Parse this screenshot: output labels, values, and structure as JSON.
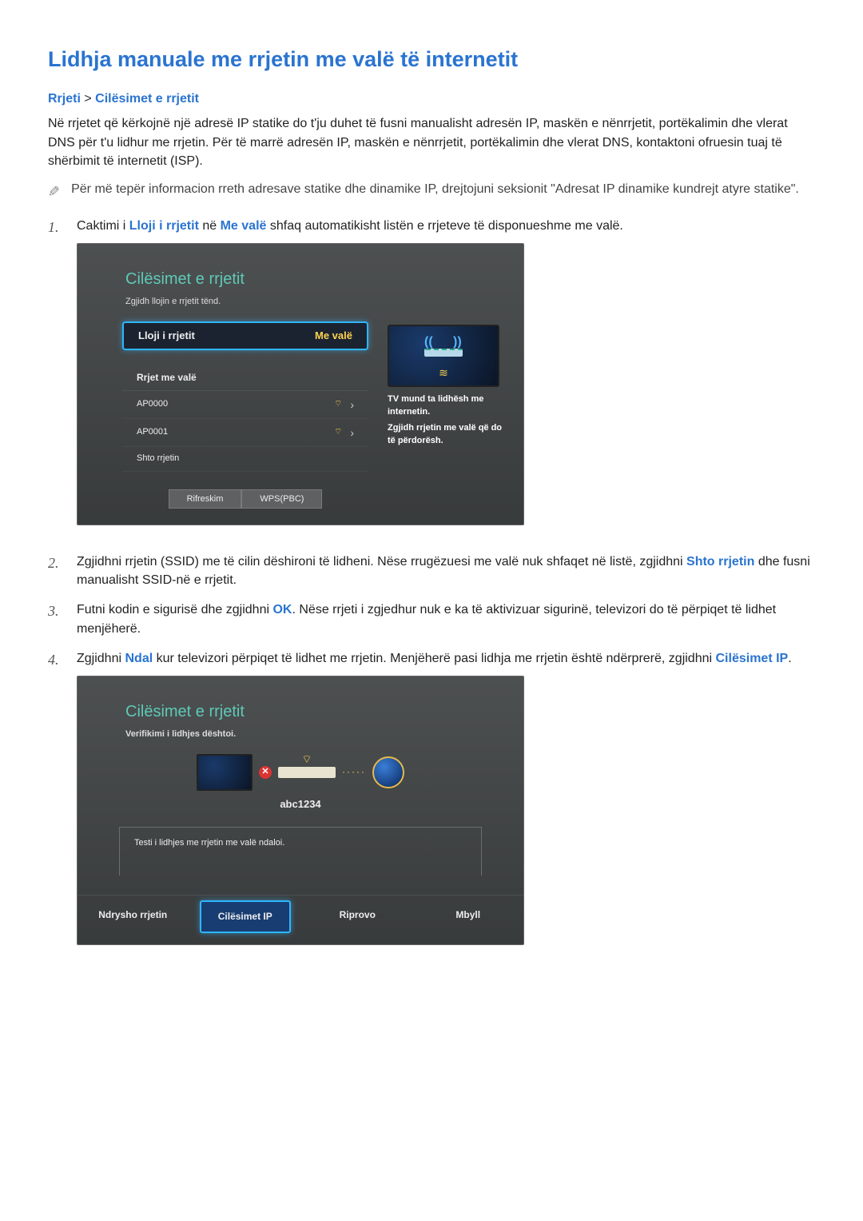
{
  "title": "Lidhja manuale me rrjetin me valë të internetit",
  "breadcrumb": {
    "a": "Rrjeti",
    "sep": ">",
    "b": "Cilësimet e rrjetit"
  },
  "intro": "Në rrjetet që kërkojnë një adresë IP statike do t'ju duhet të fusni manualisht adresën IP, maskën e nënrrjetit, portëkalimin dhe vlerat DNS për t'u lidhur me rrjetin. Për të marrë adresën IP, maskën e nënrrjetit, portëkalimin dhe vlerat DNS, kontaktoni ofruesin tuaj të shërbimit të internetit (ISP).",
  "note": "Për më tepër informacion rreth adresave statike dhe dinamike IP, drejtojuni seksionit \"Adresat IP dinamike kundrejt atyre statike\".",
  "steps": {
    "s1": {
      "num": "1.",
      "pre": "Caktimi i ",
      "kw1": "Lloji i rrjetit",
      "mid": " në ",
      "kw2": "Me valë",
      "post": " shfaq automatikisht listën e rrjeteve të disponueshme me valë."
    },
    "s2": {
      "num": "2.",
      "pre": "Zgjidhni rrjetin (SSID) me të cilin dëshironi të lidheni. Nëse rrugëzuesi me valë nuk shfaqet në listë, zgjidhni ",
      "kw": "Shto rrjetin",
      "post": " dhe fusni manualisht SSID-në e rrjetit."
    },
    "s3": {
      "num": "3.",
      "pre": "Futni kodin e sigurisë dhe zgjidhni ",
      "kw": "OK",
      "post": ". Nëse rrjeti i zgjedhur nuk e ka të aktivizuar sigurinë, televizori do të përpiqet të lidhet menjëherë."
    },
    "s4": {
      "num": "4.",
      "pre": "Zgjidhni ",
      "kw1": "Ndal",
      "mid": " kur televizori përpiqet të lidhet me rrjetin. Menjëherë pasi lidhja me rrjetin është ndërprerë, zgjidhni ",
      "kw2": "Cilësimet IP",
      "post": "."
    }
  },
  "panel1": {
    "title": "Cilësimet e rrjetit",
    "subtitle": "Zgjidh llojin e rrjetit tënd.",
    "type_label": "Lloji i rrjetit",
    "type_value": "Me valë",
    "group": "Rrjet me valë",
    "ap0": "AP0000",
    "ap1": "AP0001",
    "add": "Shto rrjetin",
    "refresh": "Rifreskim",
    "wps": "WPS(PBC)",
    "cap1": "TV mund ta lidhësh me internetin.",
    "cap2": "Zgjidh rrjetin me valë që do të përdorësh."
  },
  "panel2": {
    "title": "Cilësimet e rrjetit",
    "subtitle": "Verifikimi i lidhjes dështoi.",
    "ssid": "abc1234",
    "fail": "Testi i lidhjes me rrjetin me valë ndaloi.",
    "b1": "Ndrysho rrjetin",
    "b2": "Cilësimet IP",
    "b3": "Riprovo",
    "b4": "Mbyll"
  }
}
